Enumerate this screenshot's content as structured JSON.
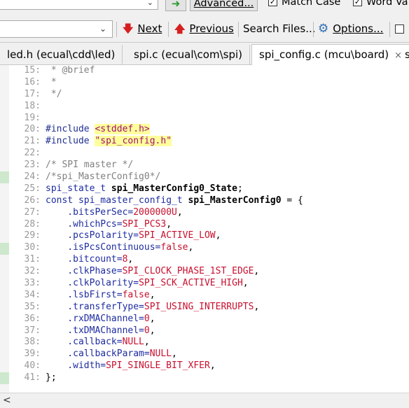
{
  "find_toolbar": {
    "go_icon": "arrow-right-icon",
    "advanced_label": "Advanced...",
    "match_case_label": "Match Case",
    "match_case_checked": true,
    "word_label": "Word Va",
    "word_checked": true
  },
  "nav_toolbar": {
    "next_label": "Next",
    "previous_label": "Previous",
    "search_files_label": "Search Files...",
    "options_label": "Options..."
  },
  "tabs": [
    {
      "label": "led.h (ecual\\cdd\\led)",
      "active": false
    },
    {
      "label": "spi.c (ecual\\com\\spi)",
      "active": false
    },
    {
      "label": "spi_config.c (mcu\\board)",
      "active": true,
      "close": "×"
    },
    {
      "label": "s",
      "active": false
    }
  ],
  "code_lines": [
    {
      "n": "15",
      "tokens": [
        {
          "t": " * @brief",
          "c": "cmt"
        }
      ]
    },
    {
      "n": "16",
      "tokens": [
        {
          "t": " *",
          "c": "cmt"
        }
      ]
    },
    {
      "n": "17",
      "tokens": [
        {
          "t": " */",
          "c": "cmt"
        }
      ]
    },
    {
      "n": "18",
      "tokens": []
    },
    {
      "n": "19",
      "tokens": []
    },
    {
      "n": "20",
      "tokens": [
        {
          "t": "#include ",
          "c": "pp"
        },
        {
          "t": "<stddef.h>",
          "c": "str"
        }
      ]
    },
    {
      "n": "21",
      "tokens": [
        {
          "t": "#include ",
          "c": "pp"
        },
        {
          "t": "\"spi_config.h\"",
          "c": "str"
        }
      ]
    },
    {
      "n": "22",
      "tokens": []
    },
    {
      "n": "23",
      "tokens": [
        {
          "t": "/* SPI master */",
          "c": "cmt"
        }
      ]
    },
    {
      "n": "24",
      "tokens": [
        {
          "t": "/*spi_MasterConfig0*/",
          "c": "cmt"
        }
      ]
    },
    {
      "n": "25",
      "tokens": [
        {
          "t": "spi_state_t ",
          "c": "id"
        },
        {
          "t": "spi_MasterConfig0_State",
          "c": "bold"
        },
        {
          "t": ";",
          "c": "sym"
        }
      ]
    },
    {
      "n": "26",
      "tokens": [
        {
          "t": "const ",
          "c": "kw"
        },
        {
          "t": "spi_master_config_t ",
          "c": "id"
        },
        {
          "t": "spi_MasterConfig0",
          "c": "bold"
        },
        {
          "t": " = {",
          "c": "sym"
        }
      ]
    },
    {
      "n": "27",
      "tokens": [
        {
          "t": "    .bitsPerSec=",
          "c": "id"
        },
        {
          "t": "2000000U",
          "c": "red"
        },
        {
          "t": ",",
          "c": "sym"
        }
      ]
    },
    {
      "n": "28",
      "tokens": [
        {
          "t": "    .whichPcs=",
          "c": "id"
        },
        {
          "t": "SPI_PCS3",
          "c": "red"
        },
        {
          "t": ",",
          "c": "sym"
        }
      ]
    },
    {
      "n": "29",
      "tokens": [
        {
          "t": "    .pcsPolarity=",
          "c": "id"
        },
        {
          "t": "SPI_ACTIVE_LOW",
          "c": "red"
        },
        {
          "t": ",",
          "c": "sym"
        }
      ]
    },
    {
      "n": "30",
      "tokens": [
        {
          "t": "    .isPcsContinuous=",
          "c": "id"
        },
        {
          "t": "false",
          "c": "red"
        },
        {
          "t": ",",
          "c": "sym"
        }
      ]
    },
    {
      "n": "31",
      "tokens": [
        {
          "t": "    .bitcount=",
          "c": "id"
        },
        {
          "t": "8",
          "c": "red"
        },
        {
          "t": ",",
          "c": "sym"
        }
      ]
    },
    {
      "n": "32",
      "tokens": [
        {
          "t": "    .clkPhase=",
          "c": "id"
        },
        {
          "t": "SPI_CLOCK_PHASE_1ST_EDGE",
          "c": "red"
        },
        {
          "t": ",",
          "c": "sym"
        }
      ]
    },
    {
      "n": "33",
      "tokens": [
        {
          "t": "    .clkPolarity=",
          "c": "id"
        },
        {
          "t": "SPI_SCK_ACTIVE_HIGH",
          "c": "red"
        },
        {
          "t": ",",
          "c": "sym"
        }
      ]
    },
    {
      "n": "34",
      "tokens": [
        {
          "t": "    .lsbFirst=",
          "c": "id"
        },
        {
          "t": "false",
          "c": "red"
        },
        {
          "t": ",",
          "c": "sym"
        }
      ]
    },
    {
      "n": "35",
      "tokens": [
        {
          "t": "    .transferType=",
          "c": "id"
        },
        {
          "t": "SPI_USING_INTERRUPTS",
          "c": "red"
        },
        {
          "t": ",",
          "c": "sym"
        }
      ]
    },
    {
      "n": "36",
      "tokens": [
        {
          "t": "    .rxDMAChannel=",
          "c": "id"
        },
        {
          "t": "0",
          "c": "red"
        },
        {
          "t": ",",
          "c": "sym"
        }
      ]
    },
    {
      "n": "37",
      "tokens": [
        {
          "t": "    .txDMAChannel=",
          "c": "id"
        },
        {
          "t": "0",
          "c": "red"
        },
        {
          "t": ",",
          "c": "sym"
        }
      ]
    },
    {
      "n": "38",
      "tokens": [
        {
          "t": "    .callback=",
          "c": "id"
        },
        {
          "t": "NULL",
          "c": "red"
        },
        {
          "t": ",",
          "c": "sym"
        }
      ]
    },
    {
      "n": "39",
      "tokens": [
        {
          "t": "    .callbackParam=",
          "c": "id"
        },
        {
          "t": "NULL",
          "c": "red"
        },
        {
          "t": ",",
          "c": "sym"
        }
      ]
    },
    {
      "n": "40",
      "tokens": [
        {
          "t": "    .width=",
          "c": "id"
        },
        {
          "t": "SPI_SINGLE_BIT_XFER",
          "c": "red"
        },
        {
          "t": ",",
          "c": "sym"
        }
      ]
    },
    {
      "n": "41",
      "tokens": [
        {
          "t": "};",
          "c": "sym"
        }
      ]
    }
  ],
  "modified_lines": [
    "24",
    "30",
    "41"
  ],
  "colors": {
    "keyword": "#1e2ca0",
    "string": "#a0106e",
    "string_highlight": "#ffff9c",
    "value": "#c8102e",
    "comment": "#808080",
    "modified_marker": "#cde8cd"
  },
  "scrollbar": {
    "left_arrow": "<"
  }
}
